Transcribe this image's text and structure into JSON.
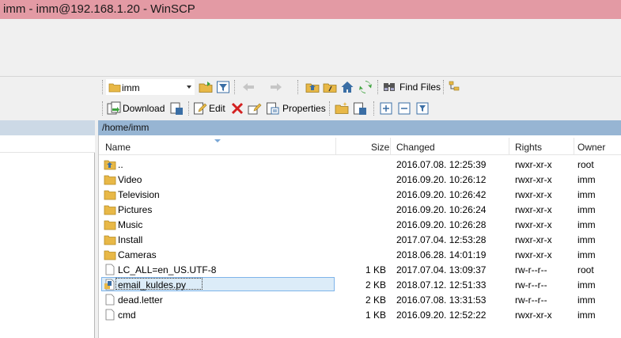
{
  "window": {
    "title": "imm - imm@192.168.1.20 - WinSCP"
  },
  "toolbar": {
    "dir_combo": "imm",
    "find_files": "Find Files",
    "download": "Download",
    "edit": "Edit",
    "properties": "Properties"
  },
  "path": "/home/imm",
  "columns": {
    "name": "Name",
    "size": "Size",
    "changed": "Changed",
    "rights": "Rights",
    "owner": "Owner"
  },
  "files": [
    {
      "name": "..",
      "size": "",
      "changed": "2016.07.08. 12:25:39",
      "rights": "rwxr-xr-x",
      "owner": "root",
      "icon": "parent-folder-icon"
    },
    {
      "name": "Video",
      "size": "",
      "changed": "2016.09.20. 10:26:12",
      "rights": "rwxr-xr-x",
      "owner": "imm",
      "icon": "folder-icon"
    },
    {
      "name": "Television",
      "size": "",
      "changed": "2016.09.20. 10:26:42",
      "rights": "rwxr-xr-x",
      "owner": "imm",
      "icon": "folder-icon"
    },
    {
      "name": "Pictures",
      "size": "",
      "changed": "2016.09.20. 10:26:24",
      "rights": "rwxr-xr-x",
      "owner": "imm",
      "icon": "folder-icon"
    },
    {
      "name": "Music",
      "size": "",
      "changed": "2016.09.20. 10:26:28",
      "rights": "rwxr-xr-x",
      "owner": "imm",
      "icon": "folder-icon"
    },
    {
      "name": "Install",
      "size": "",
      "changed": "2017.07.04. 12:53:28",
      "rights": "rwxr-xr-x",
      "owner": "imm",
      "icon": "folder-icon"
    },
    {
      "name": "Cameras",
      "size": "",
      "changed": "2018.06.28. 14:01:19",
      "rights": "rwxr-xr-x",
      "owner": "imm",
      "icon": "folder-icon"
    },
    {
      "name": "LC_ALL=en_US.UTF-8",
      "size": "1 KB",
      "changed": "2017.07.04. 13:09:37",
      "rights": "rw-r--r--",
      "owner": "root",
      "icon": "file-icon"
    },
    {
      "name": "email_kuldes.py",
      "size": "2 KB",
      "changed": "2018.07.12. 12:51:33",
      "rights": "rw-r--r--",
      "owner": "imm",
      "icon": "python-file-icon",
      "selected": true
    },
    {
      "name": "dead.letter",
      "size": "2 KB",
      "changed": "2016.07.08. 13:31:53",
      "rights": "rw-r--r--",
      "owner": "imm",
      "icon": "file-icon"
    },
    {
      "name": "cmd",
      "size": "1 KB",
      "changed": "2016.09.20. 12:52:22",
      "rights": "rwxr-xr-x",
      "owner": "imm",
      "icon": "file-icon"
    }
  ],
  "colors": {
    "titlebar": "#e39aa4",
    "pathbar": "#97b5d3",
    "selection": "#dcecf8",
    "folder": "#e8b847"
  }
}
